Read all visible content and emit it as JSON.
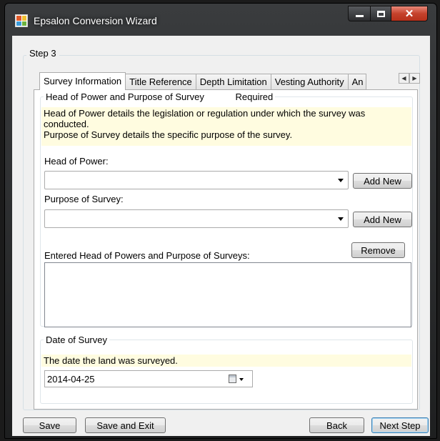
{
  "window": {
    "title": "Epsalon Conversion Wizard",
    "minimize": "",
    "maximize": "",
    "close": "✕"
  },
  "step": {
    "label": "Step 3"
  },
  "tabs": [
    {
      "label": "Survey Information",
      "active": true
    },
    {
      "label": "Title Reference"
    },
    {
      "label": "Depth Limitation"
    },
    {
      "label": "Vesting Authority"
    },
    {
      "label": "An"
    }
  ],
  "tab_scroll": {
    "left": "◀",
    "right": "▶"
  },
  "head_power_section": {
    "legend": "Head of Power and Purpose of Survey",
    "required": "Required",
    "info_line1": "Head of Power details the legislation or regulation under which the survey was",
    "info_line2": "conducted.",
    "info_line3": "Purpose of Survey details the specific purpose of the survey.",
    "head_of_power_label": "Head of Power:",
    "head_of_power_value": "",
    "purpose_label": "Purpose of Survey:",
    "purpose_value": "",
    "add_new_label": "Add New",
    "entered_label": "Entered Head of Powers and Purpose of Surveys:",
    "remove_label": "Remove",
    "entered_items": []
  },
  "date_section": {
    "legend": "Date of Survey",
    "info": "The date the land was surveyed.",
    "value": "2014-04-25"
  },
  "footer": {
    "save": "Save",
    "save_exit": "Save and Exit",
    "back": "Back",
    "next": "Next Step"
  }
}
